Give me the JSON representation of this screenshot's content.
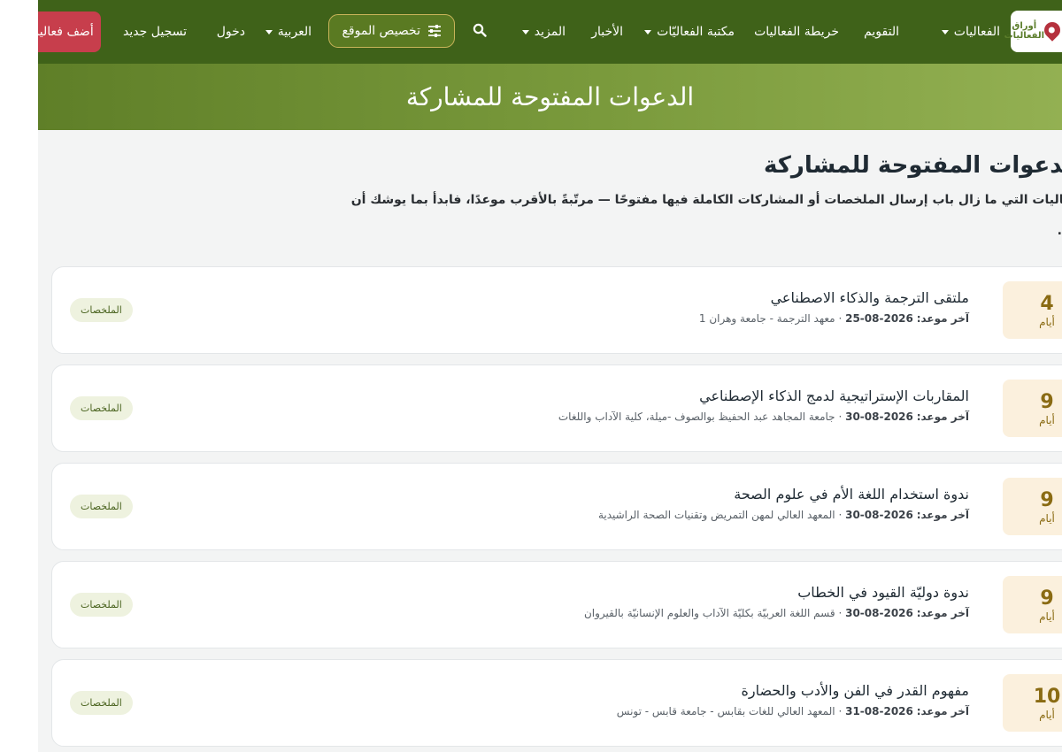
{
  "nav": {
    "logo_text": "أوراق الفعاليات",
    "items": [
      {
        "label": "الفعاليات",
        "has_caret": true
      },
      {
        "label": "التقويم",
        "has_caret": false
      },
      {
        "label": "خريطة الفعاليات",
        "has_caret": false
      },
      {
        "label": "مكتبة الفعاليّات",
        "has_caret": true
      },
      {
        "label": "الأخبار",
        "has_caret": false
      },
      {
        "label": "المزيد",
        "has_caret": true
      }
    ],
    "customize_label": "تخصيص الموقع",
    "language_label": "العربية",
    "login_label": "دخول",
    "register_label": "تسجيل جديد",
    "add_event_label": "أضف فعالية",
    "colors": {
      "nav_bg": "#3f6219",
      "accent_red": "#c73e4c",
      "accent_gold": "#c9b45a"
    }
  },
  "hero": {
    "title": "الدعوات المفتوحة للمشاركة"
  },
  "section": {
    "title": "الدعوات المفتوحة للمشاركة",
    "description": "الفعاليات التي ما زال باب إرسال الملخصات أو المشاركات الكاملة فيها مفتوحًا — مرتّبةً بالأقرب موعدًا، فابدأ بما يوشك أن",
    "description_end": "."
  },
  "calls": [
    {
      "days": "4",
      "days_label": "أيام",
      "title": "ملتقى الترجمة والذكاء الاصطناعي",
      "deadline_label": "آخر موعد:",
      "deadline": "2026-08-25",
      "organizer": "معهد الترجمة - جامعة وهران 1",
      "badge": "الملخصات"
    },
    {
      "days": "9",
      "days_label": "أيام",
      "title": "المقاربات الإستراتيجية لدمج الذكاء الإصطناعي",
      "deadline_label": "آخر موعد:",
      "deadline": "2026-08-30",
      "organizer": "جامعة المجاهد عبد الحفيظ بوالصوف -ميلة، كلية الآداب واللغات",
      "badge": "الملخصات"
    },
    {
      "days": "9",
      "days_label": "أيام",
      "title": "ندوة استخدام اللغة الأم في علوم الصحة",
      "deadline_label": "آخر موعد:",
      "deadline": "2026-08-30",
      "organizer": "المعهد العالي لمهن التمريض وتقنيات الصحة الراشيدية",
      "badge": "الملخصات"
    },
    {
      "days": "9",
      "days_label": "أيام",
      "title": "ندوة دوليّة القيود في الخطاب",
      "deadline_label": "آخر موعد:",
      "deadline": "2026-08-30",
      "organizer": "قسم اللغة العربيّة بكليّة الآداب والعلوم الإنسانيّة بالقيروان",
      "badge": "الملخصات"
    },
    {
      "days": "10",
      "days_label": "أيام",
      "title": "مفهوم القدر في الفن والأدب والحضارة",
      "deadline_label": "آخر موعد:",
      "deadline": "2026-08-31",
      "organizer": "المعهد العالي للغات بقابس - جامعة قابس - تونس",
      "badge": "الملخصات"
    }
  ]
}
